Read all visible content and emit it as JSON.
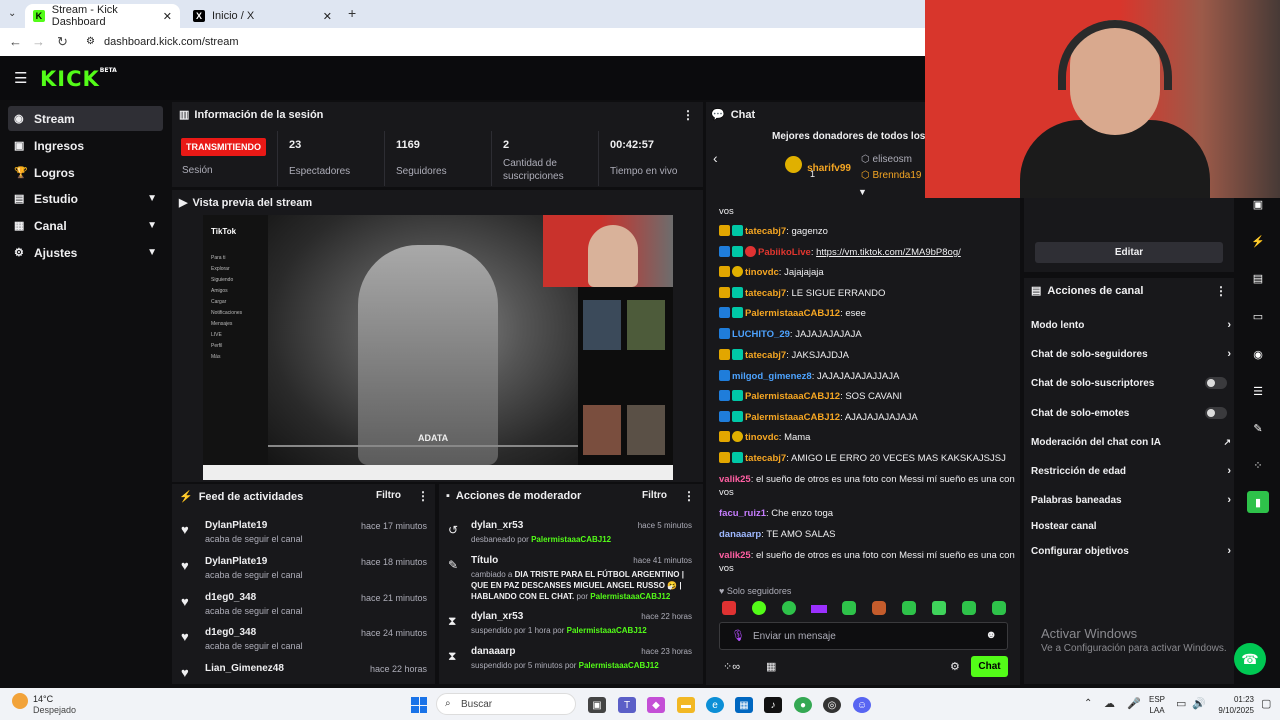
{
  "browser": {
    "tabs": [
      {
        "title": "Stream - Kick Dashboard",
        "icon": "kick-icon",
        "active": true
      },
      {
        "title": "Inicio / X",
        "icon": "x-icon",
        "active": false
      }
    ],
    "new_tab": "+",
    "url": "dashboard.kick.com/stream"
  },
  "app": {
    "logo": "KICK",
    "logo_tag": "BETA"
  },
  "sidebar": {
    "items": [
      {
        "label": "Stream",
        "icon": "stream-icon",
        "active": true
      },
      {
        "label": "Ingresos",
        "icon": "ingresos-icon"
      },
      {
        "label": "Logros",
        "icon": "trophy-icon"
      },
      {
        "label": "Estudio",
        "icon": "estudio-icon",
        "expand": true
      },
      {
        "label": "Canal",
        "icon": "canal-icon",
        "expand": true
      },
      {
        "label": "Ajustes",
        "icon": "gear-icon",
        "expand": true
      }
    ]
  },
  "session": {
    "title": "Información de la sesión",
    "live_badge": "TRANSMITIENDO",
    "session_label": "Sesión",
    "stats": [
      {
        "value": "23",
        "label": "Espectadores"
      },
      {
        "value": "1169",
        "label": "Seguidores"
      },
      {
        "value": "2",
        "label": "Cantidad de suscripciones"
      },
      {
        "value": "00:42:57",
        "label": "Tiempo en vivo"
      }
    ]
  },
  "preview": {
    "title": "Vista previa del stream",
    "screen_app": "TikTok",
    "menu": [
      "Para ti",
      "Explorar",
      "Siguiendo",
      "Amigos",
      "Cargar",
      "Notificaciones",
      "Mensajes",
      "LIVE",
      "Perfil",
      "Más"
    ],
    "brand": "ADATA"
  },
  "feed": {
    "title": "Feed de actividades",
    "filter": "Filtro",
    "items": [
      {
        "name": "DylanPlate19",
        "sub": "acaba de seguir el canal",
        "time": "hace 17 minutos"
      },
      {
        "name": "DylanPlate19",
        "sub": "acaba de seguir el canal",
        "time": "hace 18 minutos"
      },
      {
        "name": "d1eg0_348",
        "sub": "acaba de seguir el canal",
        "time": "hace 21 minutos"
      },
      {
        "name": "d1eg0_348",
        "sub": "acaba de seguir el canal",
        "time": "hace 24 minutos"
      },
      {
        "name": "Lian_Gimenez48",
        "sub": "",
        "time": "hace 22 horas"
      }
    ]
  },
  "moderator": {
    "title": "Acciones de moderador",
    "filter": "Filtro",
    "items": [
      {
        "name": "dylan_xr53",
        "sub_pre": "desbaneado por ",
        "sub_user": "PalermistaaaCABJ12",
        "sub_post": "",
        "time": "hace 5 minutos",
        "icon": "undo-icon"
      },
      {
        "name": "Título",
        "sub_pre": "cambiado a ",
        "sub_bold": "DIA TRISTE PARA EL FÚTBOL ARGENTINO | QUE EN PAZ DESCANSES MIGUEL ANGEL RUSSO 🤧 | HABLANDO CON EL CHAT.",
        "sub_mid": " por ",
        "sub_user": "PalermistaaaCABJ12",
        "time": "hace 41 minutos",
        "icon": "edit-title-icon"
      },
      {
        "name": "dylan_xr53",
        "sub_pre": "suspendido por 1 hora por ",
        "sub_user": "PalermistaaaCABJ12",
        "time": "hace 22 horas",
        "icon": "hourglass-icon"
      },
      {
        "name": "danaaarp",
        "sub_pre": "suspendido por 5 minutos por ",
        "sub_user": "PalermistaaaCABJ12",
        "time": "hace 23 horas",
        "icon": "hourglass-icon"
      }
    ]
  },
  "chat": {
    "title": "Chat",
    "donors_title": "Mejores donadores de todos los ti",
    "donors": [
      {
        "name": "sharifv99",
        "count": "1"
      },
      {
        "name": "eliseosm"
      },
      {
        "name": "Brennda19"
      }
    ],
    "messages": [
      {
        "user": "",
        "text": "vos",
        "color": "#efeff1"
      },
      {
        "user": "tatecabj7",
        "text": "gagenzo",
        "color": "#f5a623",
        "badges": [
          "crown",
          "mod"
        ]
      },
      {
        "user": "PabiikoLive",
        "text": "https://vm.tiktok.com/ZMA9bP8og/",
        "color": "#e0362f",
        "badges": [
          "sub",
          "mod",
          "red"
        ],
        "link": true
      },
      {
        "user": "tinovdc",
        "text": "Jajajajaja",
        "color": "#f5a623",
        "badges": [
          "crown",
          "gift"
        ]
      },
      {
        "user": "tatecabj7",
        "text": "LE SIGUE ERRANDO",
        "color": "#f5a623",
        "badges": [
          "crown",
          "mod"
        ]
      },
      {
        "user": "PalermistaaaCABJ12",
        "text": "esee",
        "color": "#f5a623",
        "badges": [
          "sub",
          "mod"
        ]
      },
      {
        "user": "LUCHITO_29",
        "text": "JAJAJAJAJAJA",
        "color": "#4da3ff",
        "badges": [
          "sub"
        ]
      },
      {
        "user": "tatecabj7",
        "text": "JAKSJAJDJA",
        "color": "#f5a623",
        "badges": [
          "crown",
          "mod"
        ]
      },
      {
        "user": "milgod_gimenez8",
        "text": "JAJAJAJAJAJJAJA",
        "color": "#4da3ff",
        "badges": [
          "sub"
        ]
      },
      {
        "user": "PalermistaaaCABJ12",
        "text": "SOS CAVANI",
        "color": "#f5a623",
        "badges": [
          "sub",
          "mod"
        ]
      },
      {
        "user": "PalermistaaaCABJ12",
        "text": "AJAJAJAJAJAJA",
        "color": "#f5a623",
        "badges": [
          "sub",
          "mod"
        ]
      },
      {
        "user": "tinovdc",
        "text": "Mama",
        "color": "#f5a623",
        "badges": [
          "crown",
          "gift"
        ]
      },
      {
        "user": "tatecabj7",
        "text": "AMIGO LE ERRO 20 VECES MAS KAKSKAJSJSJ",
        "color": "#f5a623",
        "badges": [
          "crown",
          "mod"
        ]
      },
      {
        "user": "valik25",
        "text": "el sueño de otros es una foto con Messi mí sueño es una con vos",
        "color": "#ff5fa2",
        "badges": []
      },
      {
        "user": "facu_ruiz1",
        "text": "Che enzo toga",
        "color": "#c77dff",
        "badges": []
      },
      {
        "user": "danaaarp",
        "text": "TE AMO SALAS",
        "color": "#9eb8ff",
        "badges": []
      },
      {
        "user": "valik25",
        "text": "el sueño de otros es una foto con Messi mí sueño es una con vos",
        "color": "#ff5fa2",
        "badges": []
      }
    ],
    "mode": "Solo seguidores",
    "input_placeholder": "Enviar un mensaje",
    "send": "Chat"
  },
  "channel": {
    "edit": "Editar",
    "actions_title": "Acciones de canal",
    "actions": [
      {
        "label": "Modo lento",
        "kind": "chevron"
      },
      {
        "label": "Chat de solo-seguidores",
        "kind": "chevron"
      },
      {
        "label": "Chat de solo-suscriptores",
        "kind": "toggle"
      },
      {
        "label": "Chat de solo-emotes",
        "kind": "toggle"
      },
      {
        "label": "Moderación del chat con IA",
        "kind": "external"
      },
      {
        "label": "Restricción de edad",
        "kind": "chevron"
      },
      {
        "label": "Palabras baneadas",
        "kind": "chevron"
      },
      {
        "label": "Hostear canal",
        "kind": "none"
      },
      {
        "label": "Configurar objetivos",
        "kind": "chevron"
      }
    ],
    "watermark_title": "Activar Windows",
    "watermark_sub": "Ve a Configuración para activar Windows."
  },
  "taskbar": {
    "weather_temp": "14°C",
    "weather_desc": "Despejado",
    "search": "Buscar",
    "lang": "ESP",
    "lang2": "LAA",
    "time": "01:23",
    "date": "9/10/2025"
  },
  "colors": {
    "accent": "#53fc18",
    "live": "#e91916",
    "panel": "#18181b"
  }
}
